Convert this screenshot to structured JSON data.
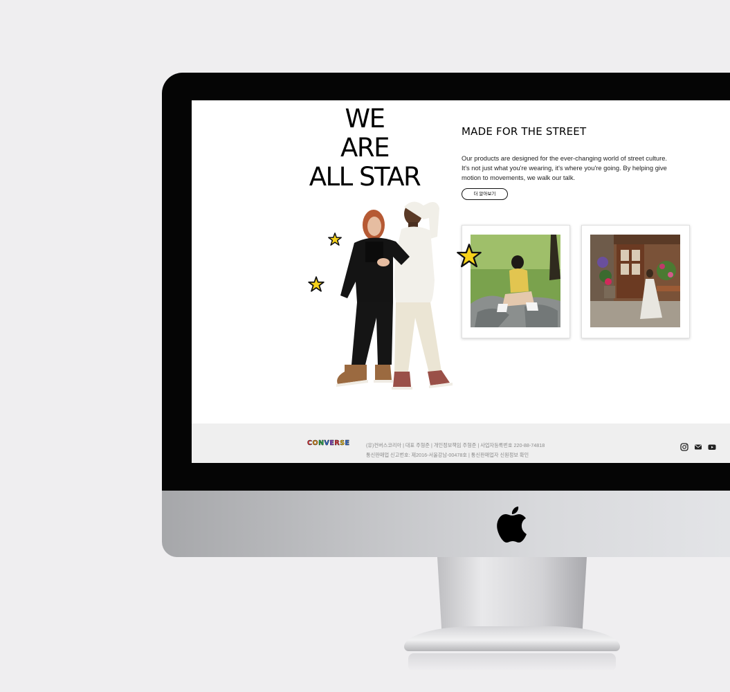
{
  "hero": {
    "title_lines": [
      "WE",
      "ARE",
      "ALL STAR"
    ]
  },
  "section": {
    "title": "MADE FOR THE STREET",
    "body": "Our products are designed for the ever-changing world of street culture. It's not just what you're wearing, it's where you're going. By helping give motion to movements, we walk our talk.",
    "more_label": "더 알아보기"
  },
  "footer": {
    "brand": "CONVERSE",
    "line1": "(유)컨버스코리아 | 대표 주형준 | 개인정보책임 주형준 | 사업자등록번호 220-88-74818",
    "line2": "통신판매업 신고번호: 제2016-서울강남-00478호 | 통신판매업자 신원정보 확인",
    "line3": "",
    "brand_colors": [
      "#e8343a",
      "#f39a1f",
      "#2cb24f",
      "#2f6fd8",
      "#8b3fcf",
      "#e8343a",
      "#f5c518",
      "#2f6fd8"
    ],
    "social_icons": [
      "instagram-icon",
      "mail-icon",
      "youtube-icon"
    ]
  },
  "colors": {
    "star": "#f6d21a",
    "background": "#efeef0",
    "footer_bg": "#efefef"
  }
}
